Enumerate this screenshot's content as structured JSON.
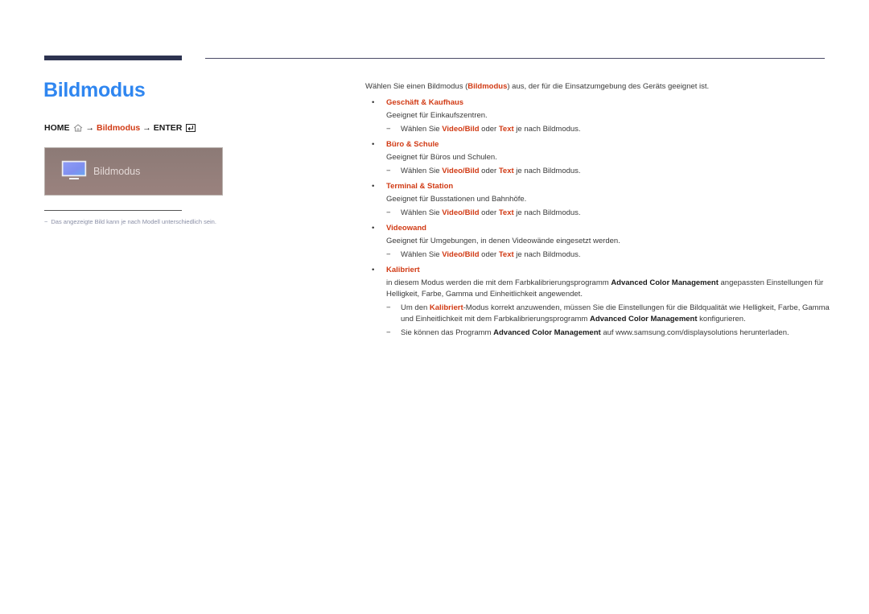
{
  "page": {
    "title": "Bildmodus",
    "breadcrumb": {
      "home": "HOME",
      "arrow1": "→",
      "item": "Bildmodus",
      "arrow2": "→",
      "enter": "ENTER",
      "home_icon": "home-icon",
      "enter_icon": "enter-icon"
    },
    "panel": {
      "label": "Bildmodus",
      "icon": "monitor-icon"
    },
    "footnote": {
      "dash": "−",
      "text": "Das angezeigte Bild kann je nach Modell unterschiedlich sein."
    },
    "colors": {
      "title": "#2f86f0",
      "accent_red": "#d13a14",
      "top_bar": "#2d3350"
    }
  },
  "content": {
    "intro": {
      "pre": "Wählen Sie einen Bildmodus (",
      "em": "Bildmodus",
      "post": ") aus, der für die Einsatzumgebung des Geräts geeignet ist."
    },
    "bullet": "•",
    "dash": "−",
    "sections": [
      {
        "heading": "Geschäft & Kaufhaus",
        "desc": "Geeignet für Einkaufszentren.",
        "note": {
          "pre": "Wählen Sie ",
          "em1": "Video/Bild",
          "mid": " oder ",
          "em2": "Text",
          "post": " je nach Bildmodus."
        }
      },
      {
        "heading": "Büro & Schule",
        "desc": "Geeignet für Büros und Schulen.",
        "note": {
          "pre": "Wählen Sie ",
          "em1": "Video/Bild",
          "mid": " oder ",
          "em2": "Text",
          "post": " je nach Bildmodus."
        }
      },
      {
        "heading": "Terminal & Station",
        "desc": "Geeignet für Busstationen und Bahnhöfe.",
        "note": {
          "pre": "Wählen Sie ",
          "em1": "Video/Bild",
          "mid": " oder ",
          "em2": "Text",
          "post": " je nach Bildmodus."
        }
      },
      {
        "heading": "Videowand",
        "desc": "Geeignet für Umgebungen, in denen Videowände eingesetzt werden.",
        "note": {
          "pre": "Wählen Sie ",
          "em1": "Video/Bild",
          "mid": " oder ",
          "em2": "Text",
          "post": " je nach Bildmodus."
        }
      }
    ],
    "kalibriert": {
      "heading": "Kalibriert",
      "desc_pre": "in diesem Modus werden die mit dem Farbkalibrierungsprogramm ",
      "desc_em": "Advanced Color Management",
      "desc_post": " angepassten Einstellungen für Helligkeit, Farbe, Gamma und Einheitlichkeit angewendet.",
      "note1_pre": "Um den ",
      "note1_em": "Kalibriert",
      "note1_mid": "-Modus korrekt anzuwenden, müssen Sie die Einstellungen für die Bildqualität wie Helligkeit, Farbe, Gamma und Einheitlichkeit mit dem Farbkalibrierungsprogramm ",
      "note1_em2": "Advanced Color Management",
      "note1_post": " konfigurieren.",
      "note2_pre": "Sie können das Programm ",
      "note2_em": "Advanced Color Management",
      "note2_post": " auf www.samsung.com/displaysolutions herunterladen."
    }
  }
}
